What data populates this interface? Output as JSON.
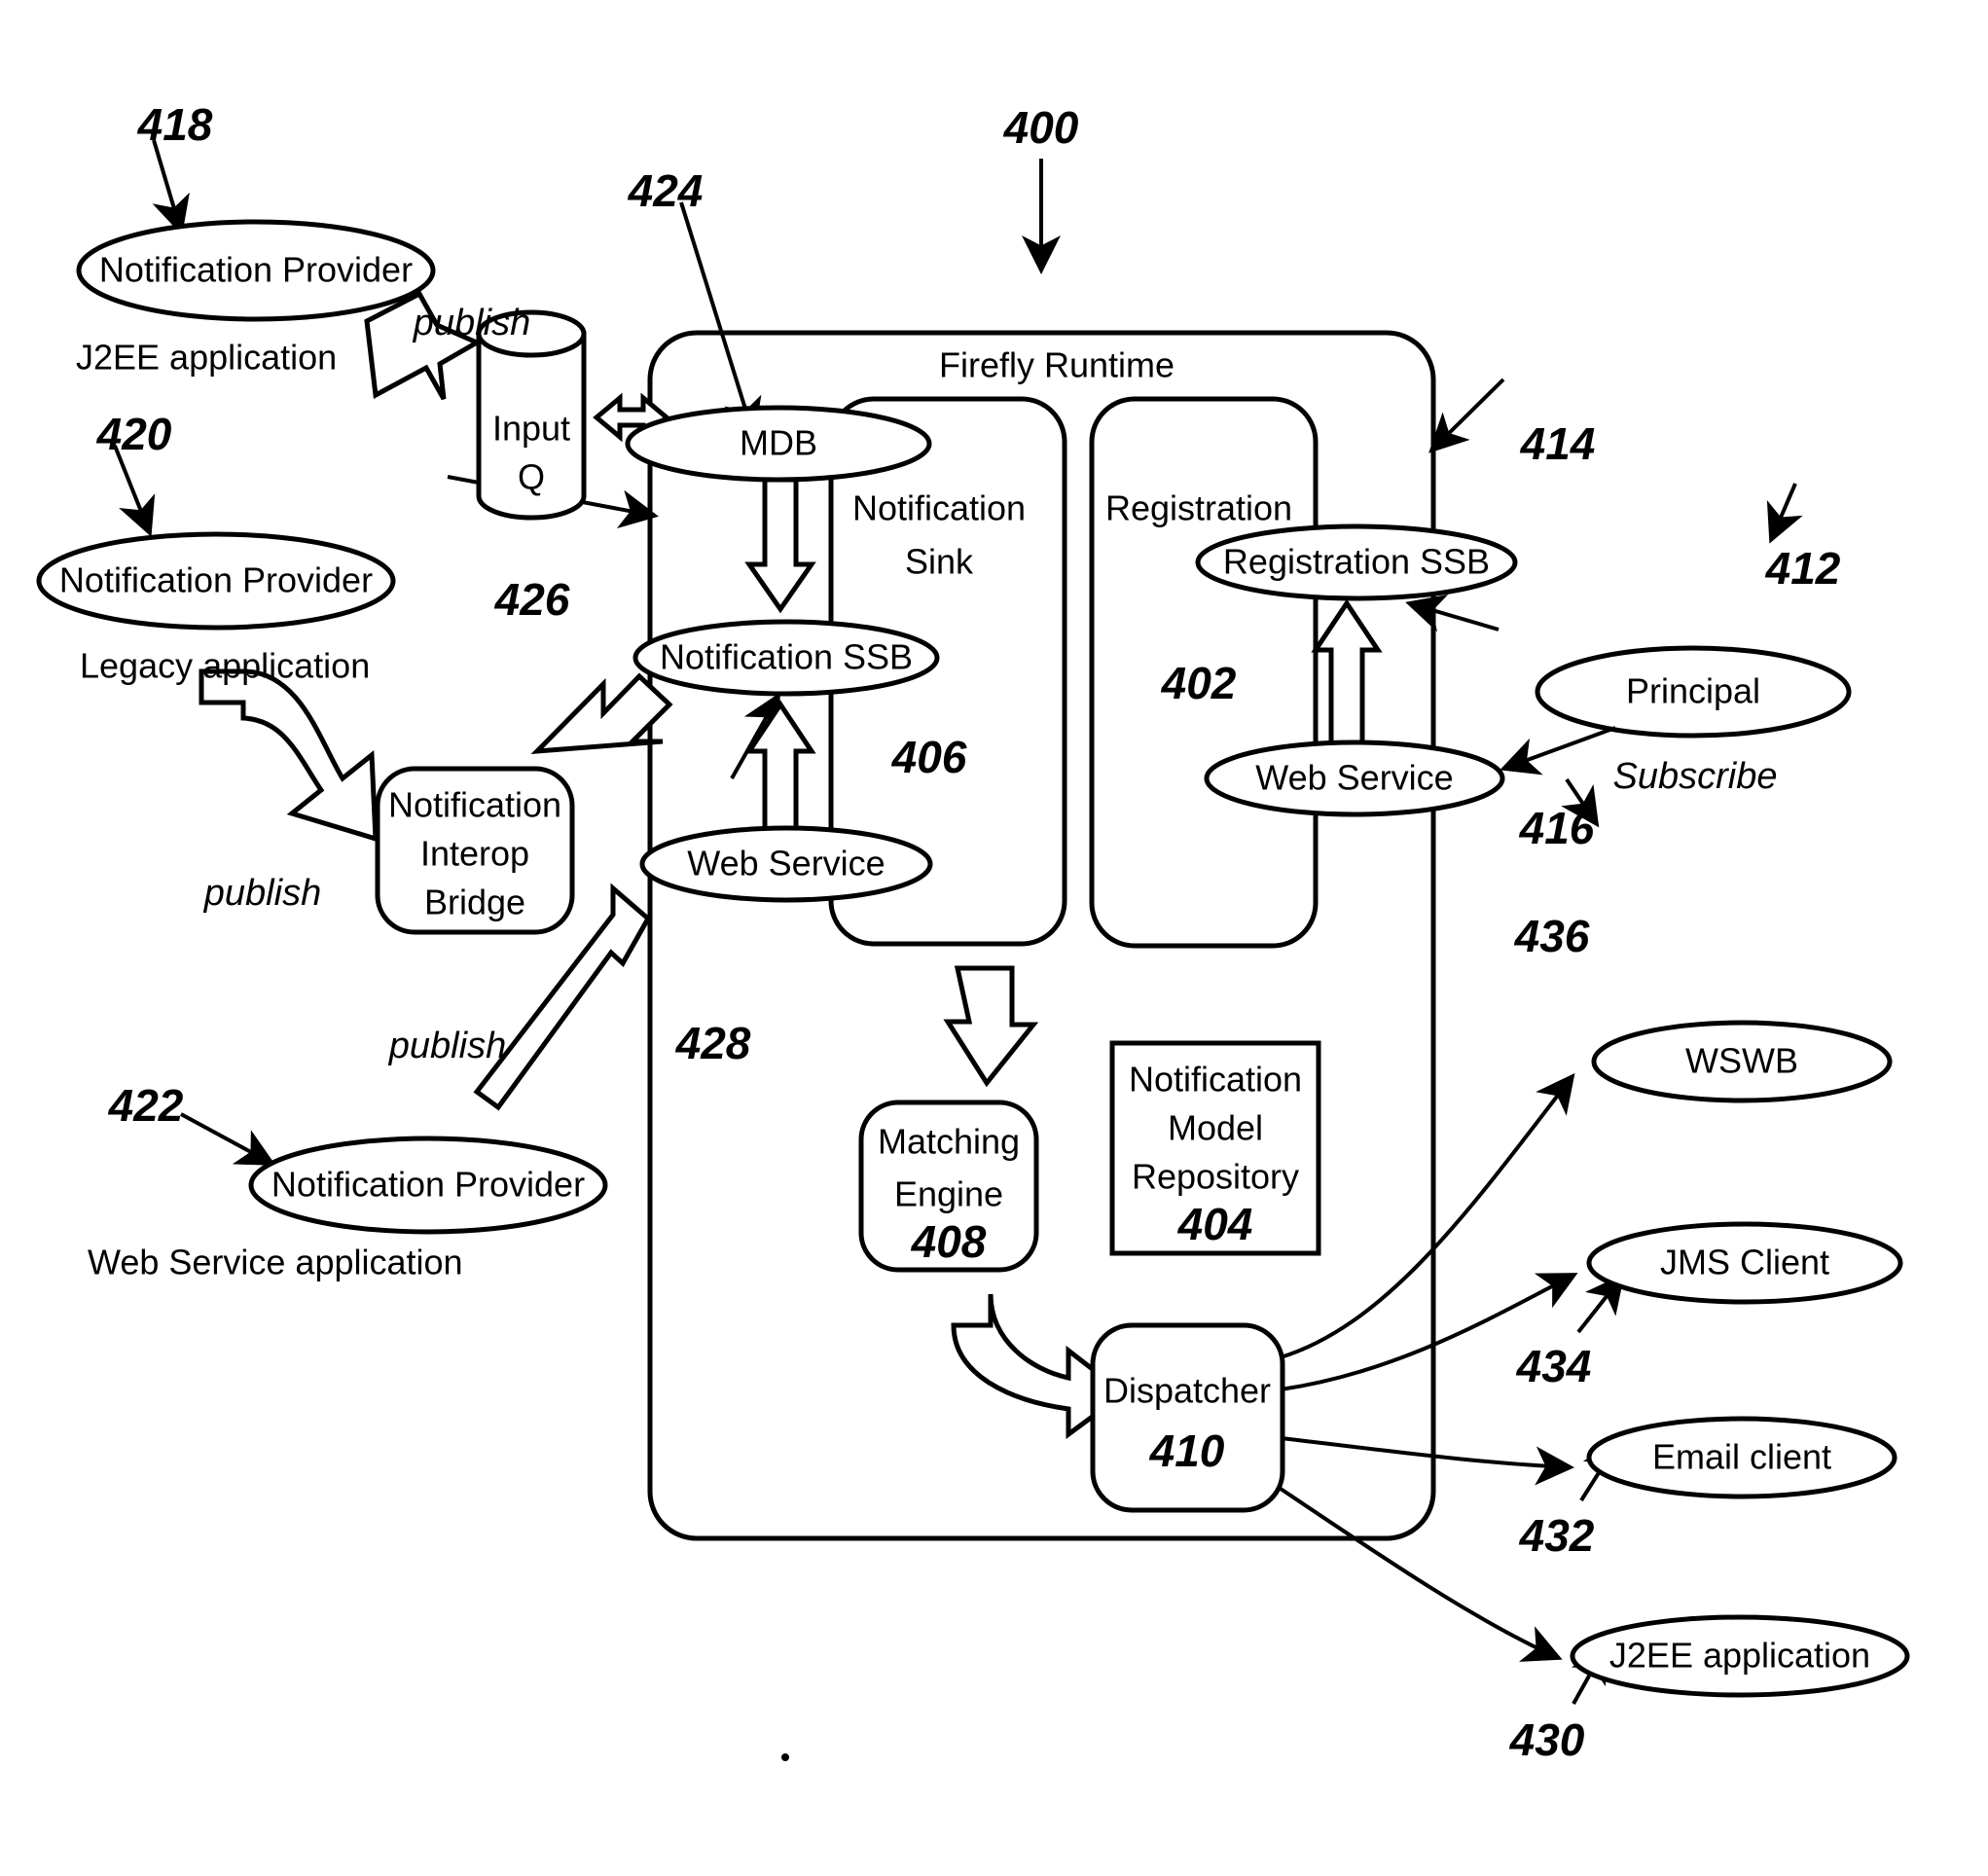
{
  "figure": {
    "title": "Firefly Runtime notification architecture",
    "reference_numeral": "400"
  },
  "runtime": {
    "label": "Firefly Runtime",
    "ref": "400"
  },
  "notification_sink": {
    "label_line1": "Notification",
    "label_line2": "Sink",
    "ref": "406",
    "nodes": {
      "mdb": {
        "label": "MDB",
        "ref": "424"
      },
      "notification_ssb": {
        "label": "Notification SSB",
        "ref": "426"
      },
      "web_service": {
        "label": "Web Service",
        "ref": "428"
      }
    }
  },
  "registration": {
    "label": "Registration",
    "ref": "402",
    "nodes": {
      "registration_ssb": {
        "label": "Registration SSB",
        "ref": "414"
      },
      "web_service": {
        "label": "Web Service",
        "ref": "416"
      }
    }
  },
  "matching_engine": {
    "label_line1": "Matching",
    "label_line2": "Engine",
    "ref": "408"
  },
  "model_repository": {
    "label_line1": "Notification",
    "label_line2": "Model",
    "label_line3": "Repository",
    "ref": "404"
  },
  "dispatcher": {
    "label": "Dispatcher",
    "ref": "410"
  },
  "input_queue": {
    "label_line1": "Input",
    "label_line2": "Q"
  },
  "interop_bridge": {
    "label_line1": "Notification",
    "label_line2": "Interop",
    "label_line3": "Bridge"
  },
  "providers": [
    {
      "label": "Notification Provider",
      "caption": "J2EE application",
      "ref": "418",
      "edge_label": "publish"
    },
    {
      "label": "Notification Provider",
      "caption": "Legacy application",
      "ref": "420",
      "edge_label": "publish"
    },
    {
      "label": "Notification Provider",
      "caption": "Web Service application",
      "ref": "422",
      "edge_label": "publish"
    }
  ],
  "principal": {
    "label": "Principal",
    "ref": "412",
    "edge_label": "Subscribe"
  },
  "consumers": [
    {
      "label": "WSWB",
      "ref": "436"
    },
    {
      "label": "JMS Client",
      "ref": "434"
    },
    {
      "label": "Email client",
      "ref": "432"
    },
    {
      "label": "J2EE application",
      "ref": "430"
    }
  ],
  "colors": {
    "stroke": "#000000",
    "background": "#ffffff"
  }
}
